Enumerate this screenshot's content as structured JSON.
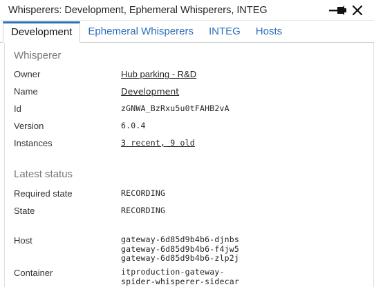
{
  "window": {
    "title": "Whisperers: Development, Ephemeral Whisperers, INTEG"
  },
  "tabs": [
    {
      "label": "Development"
    },
    {
      "label": "Ephemeral Whisperers"
    },
    {
      "label": "INTEG"
    },
    {
      "label": "Hosts"
    }
  ],
  "whisperer": {
    "section_title": "Whisperer",
    "owner_label": "Owner",
    "owner_value": "Hub parking - R&D",
    "name_label": "Name",
    "name_value": "Development",
    "id_label": "Id",
    "id_value": "zGNWA_BzRxu5u0tFAHB2vA",
    "version_label": "Version",
    "version_value": "6.0.4",
    "instances_label": "Instances",
    "instances_value": "3 recent, 9 old"
  },
  "status": {
    "section_title": "Latest status",
    "required_state_label": "Required state",
    "required_state_value": "RECORDING",
    "state_label": "State",
    "state_value": "RECORDING",
    "host_label": "Host",
    "hosts": [
      "gateway-6d85d9b4b6-djnbs",
      "gateway-6d85d9b4b6-f4jw5",
      "gateway-6d85d9b4b6-zlp2j"
    ],
    "container_label": "Container",
    "containers": [
      "itproduction-gateway-",
      "spider-whisperer-sidecar"
    ]
  },
  "colors": {
    "accent": "#2a6fb7",
    "muted": "#777777"
  },
  "icons": [
    "pin-icon",
    "close-icon"
  ]
}
